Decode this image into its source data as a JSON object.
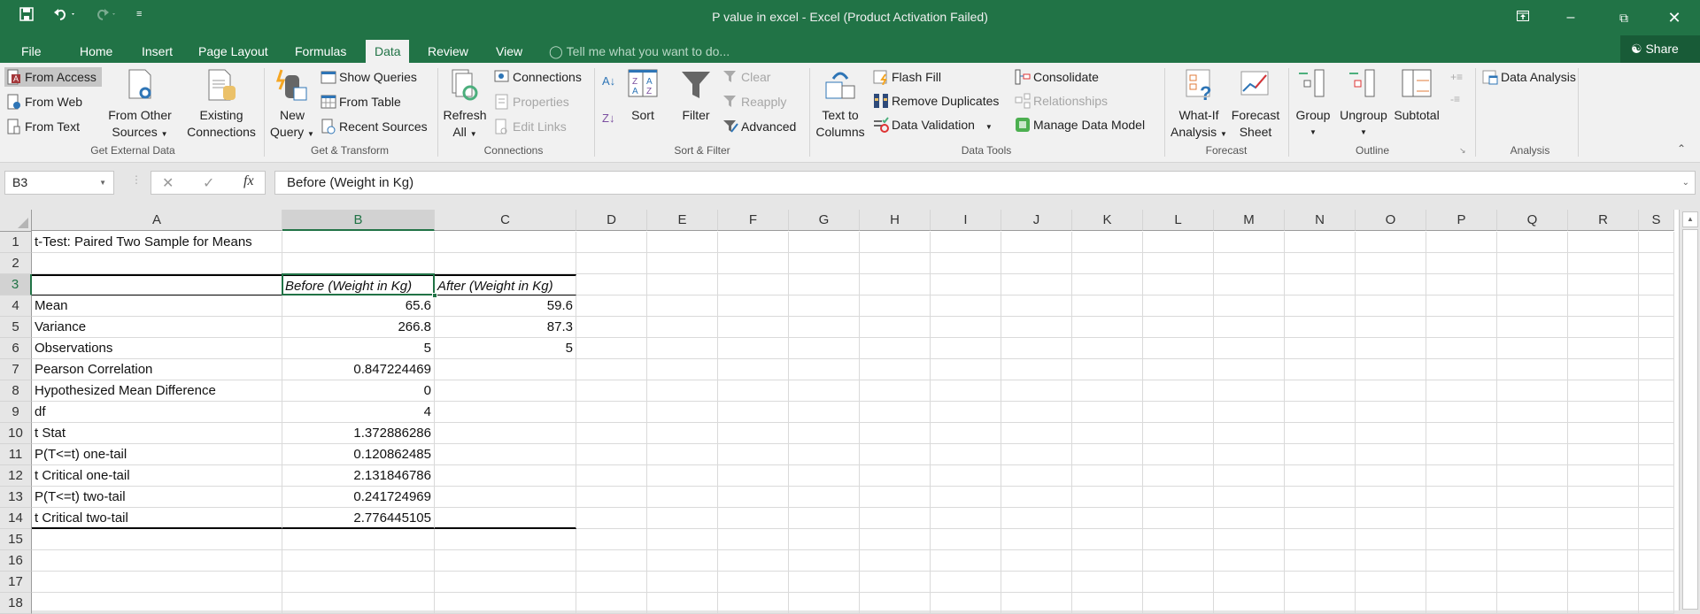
{
  "titlebar": {
    "title": "P value in excel - Excel (Product Activation Failed)",
    "save_icon": "save-icon",
    "undo_icon": "undo-icon",
    "redo_icon": "redo-icon",
    "customize_icon": "customize-qat-icon",
    "ribbon_display_icon": "ribbon-display-options-icon",
    "minimize_icon": "minimize-icon",
    "restore_icon": "restore-icon",
    "close_icon": "close-icon"
  },
  "tabs": [
    {
      "label": "File"
    },
    {
      "label": "Home"
    },
    {
      "label": "Insert"
    },
    {
      "label": "Page Layout"
    },
    {
      "label": "Formulas"
    },
    {
      "label": "Data",
      "active": true
    },
    {
      "label": "Review"
    },
    {
      "label": "View"
    }
  ],
  "tellme": "Tell me what you want to do...",
  "share": "Share",
  "ribbon": {
    "get_external": {
      "label": "Get External Data",
      "from_access": "From Access",
      "from_web": "From Web",
      "from_text": "From Text",
      "from_other_1": "From Other",
      "from_other_2": "Sources",
      "existing_1": "Existing",
      "existing_2": "Connections"
    },
    "get_transform": {
      "label": "Get & Transform",
      "new_query_1": "New",
      "new_query_2": "Query",
      "show_queries": "Show Queries",
      "from_table": "From Table",
      "recent_sources": "Recent Sources"
    },
    "connections": {
      "label": "Connections",
      "refresh_1": "Refresh",
      "refresh_2": "All",
      "connections": "Connections",
      "properties": "Properties",
      "edit_links": "Edit Links"
    },
    "sort_filter": {
      "label": "Sort & Filter",
      "sort": "Sort",
      "filter": "Filter",
      "clear": "Clear",
      "reapply": "Reapply",
      "advanced": "Advanced"
    },
    "data_tools": {
      "label": "Data Tools",
      "text_to_1": "Text to",
      "text_to_2": "Columns",
      "flash_fill": "Flash Fill",
      "remove_duplicates": "Remove Duplicates",
      "data_validation": "Data Validation",
      "consolidate": "Consolidate",
      "relationships": "Relationships",
      "manage_model": "Manage Data Model"
    },
    "forecast": {
      "label": "Forecast",
      "whatif_1": "What-If",
      "whatif_2": "Analysis",
      "forecast_1": "Forecast",
      "forecast_2": "Sheet"
    },
    "outline": {
      "label": "Outline",
      "group": "Group",
      "ungroup": "Ungroup",
      "subtotal": "Subtotal"
    },
    "analysis": {
      "label": "Analysis",
      "data_analysis": "Data Analysis"
    }
  },
  "formula_bar": {
    "name_box": "B3",
    "content": "Before (Weight in Kg)"
  },
  "columns": [
    "A",
    "B",
    "C",
    "D",
    "E",
    "F",
    "G",
    "H",
    "I",
    "J",
    "K",
    "L",
    "M",
    "N",
    "O",
    "P",
    "Q",
    "R",
    "S"
  ],
  "rows": [
    "1",
    "2",
    "3",
    "4",
    "5",
    "6",
    "7",
    "8",
    "9",
    "10",
    "11",
    "12",
    "13",
    "14",
    "15",
    "16",
    "17",
    "18"
  ],
  "sheet": {
    "title": "t-Test: Paired Two Sample for Means",
    "header_b": "Before (Weight in Kg)",
    "header_c": "After (Weight in Kg)",
    "stats": [
      {
        "label": "Mean",
        "b": "65.6",
        "c": "59.6"
      },
      {
        "label": "Variance",
        "b": "266.8",
        "c": "87.3"
      },
      {
        "label": "Observations",
        "b": "5",
        "c": "5"
      },
      {
        "label": "Pearson Correlation",
        "b": "0.847224469",
        "c": ""
      },
      {
        "label": "Hypothesized Mean Difference",
        "b": "0",
        "c": ""
      },
      {
        "label": "df",
        "b": "4",
        "c": ""
      },
      {
        "label": "t Stat",
        "b": "1.372886286",
        "c": ""
      },
      {
        "label": "P(T<=t) one-tail",
        "b": "0.120862485",
        "c": ""
      },
      {
        "label": "t Critical one-tail",
        "b": "2.131846786",
        "c": ""
      },
      {
        "label": "P(T<=t) two-tail",
        "b": "0.241724969",
        "c": ""
      },
      {
        "label": "t Critical two-tail",
        "b": "2.776445105",
        "c": ""
      }
    ]
  },
  "colors": {
    "accent": "#217346",
    "ribbon": "#f1f1f1"
  }
}
